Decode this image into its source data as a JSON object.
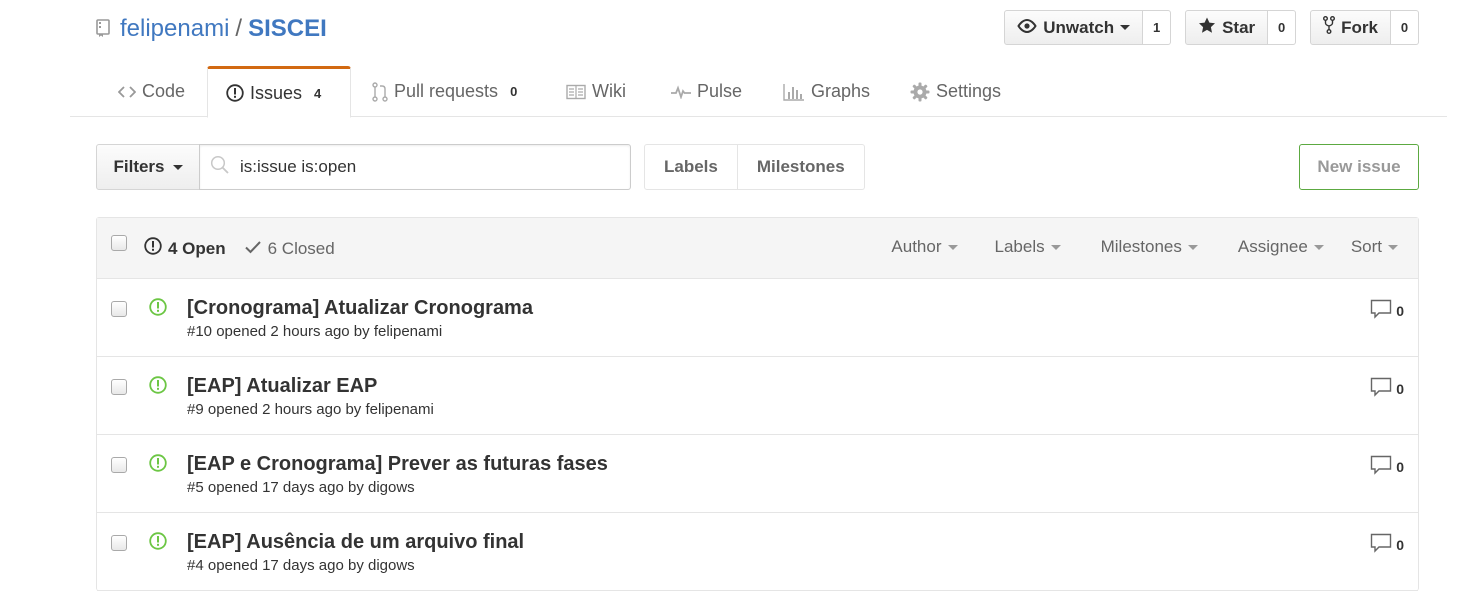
{
  "repo": {
    "owner": "felipenami",
    "separator": "/",
    "name": "SISCEI"
  },
  "actions": {
    "watch": {
      "label": "Unwatch",
      "count": "1"
    },
    "star": {
      "label": "Star",
      "count": "0"
    },
    "fork": {
      "label": "Fork",
      "count": "0"
    }
  },
  "tabs": [
    {
      "label": "Code",
      "icon": "code-icon"
    },
    {
      "label": "Issues",
      "counter": "4",
      "icon": "issue-opened-icon"
    },
    {
      "label": "Pull requests",
      "counter": "0",
      "icon": "git-pull-request-icon"
    },
    {
      "label": "Wiki",
      "icon": "book-icon"
    },
    {
      "label": "Pulse",
      "icon": "pulse-icon"
    },
    {
      "label": "Graphs",
      "icon": "graph-icon"
    },
    {
      "label": "Settings",
      "icon": "gear-icon"
    }
  ],
  "subnav": {
    "filters_label": "Filters",
    "search_value": "is:issue is:open",
    "labels_label": "Labels",
    "milestones_label": "Milestones",
    "new_issue_label": "New issue"
  },
  "table_header": {
    "open_label": "4 Open",
    "closed_label": "6 Closed",
    "filters": [
      "Author",
      "Labels",
      "Milestones",
      "Assignee",
      "Sort"
    ]
  },
  "issues": [
    {
      "title": "[Cronograma] Atualizar Cronograma",
      "meta": "#10 opened 2 hours ago by felipenami",
      "comments": "0"
    },
    {
      "title": "[EAP] Atualizar EAP",
      "meta": "#9 opened 2 hours ago by felipenami",
      "comments": "0"
    },
    {
      "title": "[EAP e Cronograma] Prever as futuras fases",
      "meta": "#5 opened 17 days ago by digows",
      "comments": "0"
    },
    {
      "title": "[EAP] Ausência de um arquivo final",
      "meta": "#4 opened 17 days ago by digows",
      "comments": "0"
    }
  ],
  "colors": {
    "link": "#4078c0",
    "selected_tab_accent": "#d26911",
    "open_issue": "#6cc644",
    "new_issue_border": "#5ca941"
  }
}
